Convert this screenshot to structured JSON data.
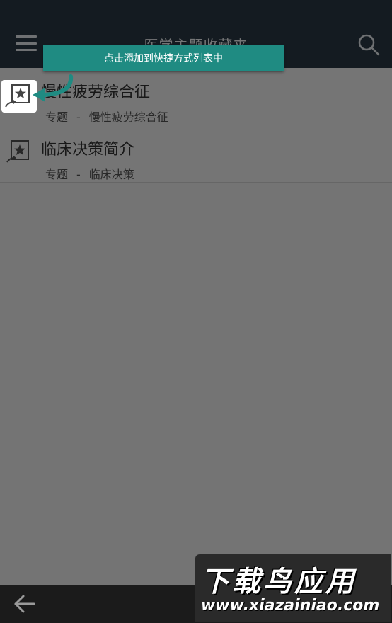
{
  "header": {
    "title": "医学主题收藏夹",
    "menu_icon": "hamburger-menu-icon",
    "search_icon": "search-icon",
    "background_color": "#2b3a45"
  },
  "tooltip": {
    "text": "点击添加到快捷方式列表中",
    "color": "#1f8b82"
  },
  "list": {
    "items": [
      {
        "title": "慢性疲劳综合征",
        "type": "专题",
        "separator": "-",
        "topic": "慢性疲劳综合征",
        "icon": "add-shortcut-star-icon"
      },
      {
        "title": "临床决策简介",
        "type": "专题",
        "separator": "-",
        "topic": "临床决策",
        "icon": "add-shortcut-star-icon"
      }
    ]
  },
  "bottom_bar": {
    "back_icon": "back-arrow-icon"
  },
  "watermark": {
    "title": "下载鸟应用",
    "url": "www.xiazainiao.com"
  }
}
